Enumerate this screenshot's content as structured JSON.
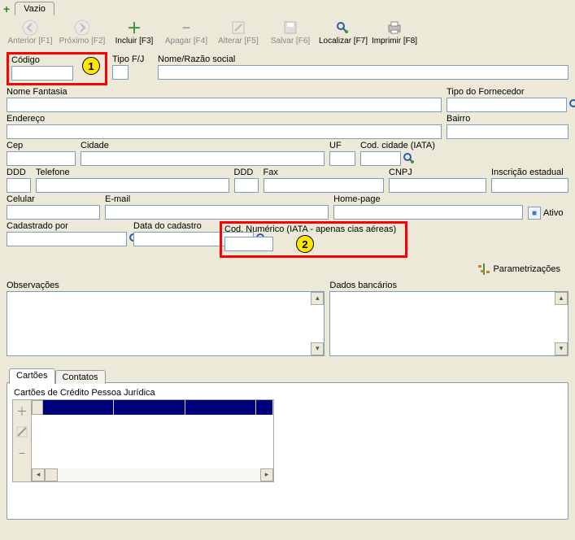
{
  "topTab": "Vazio",
  "toolbar": [
    {
      "label": "Anterior [F1]",
      "icon": "arrow-left",
      "enabled": false
    },
    {
      "label": "Próximo [F2]",
      "icon": "arrow-right",
      "enabled": false
    },
    {
      "label": "Incluir [F3]",
      "icon": "plus",
      "enabled": true
    },
    {
      "label": "Apagar [F4]",
      "icon": "minus",
      "enabled": false
    },
    {
      "label": "Alterar [F5]",
      "icon": "edit",
      "enabled": false
    },
    {
      "label": "Salvar [F6]",
      "icon": "save",
      "enabled": false
    },
    {
      "label": "Localizar [F7]",
      "icon": "search",
      "enabled": true
    },
    {
      "label": "Imprimir [F8]",
      "icon": "print",
      "enabled": true
    }
  ],
  "labels": {
    "codigo": "Código",
    "tipofj": "Tipo F/J",
    "nomerazao": "Nome/Razão social",
    "nomefantasia": "Nome Fantasia",
    "tipofornecedor": "Tipo do Fornecedor",
    "endereco": "Endereço",
    "bairro": "Bairro",
    "cep": "Cep",
    "cidade": "Cidade",
    "uf": "UF",
    "codcidade": "Cod. cidade (IATA)",
    "ddd1": "DDD",
    "telefone": "Telefone",
    "ddd2": "DDD",
    "fax": "Fax",
    "cnpj": "CNPJ",
    "inscricao": "Inscrição estadual",
    "celular": "Celular",
    "email": "E-mail",
    "homepage": "Home-page",
    "ativo": "Ativo",
    "cadastradopor": "Cadastrado por",
    "datacadastro": "Data do cadastro",
    "codnumerico": "Cod. Numérico (IATA - apenas cias aéreas)",
    "parametrizacoes": "Parametrizações",
    "observacoes": "Observações",
    "dadosbancarios": "Dados bancários",
    "cartoes": "Cartões",
    "contatos": "Contatos",
    "cartoesgrid": "Cartões de Crédito Pessoa Jurídica"
  },
  "annotations": {
    "badge1": "1",
    "badge2": "2"
  }
}
